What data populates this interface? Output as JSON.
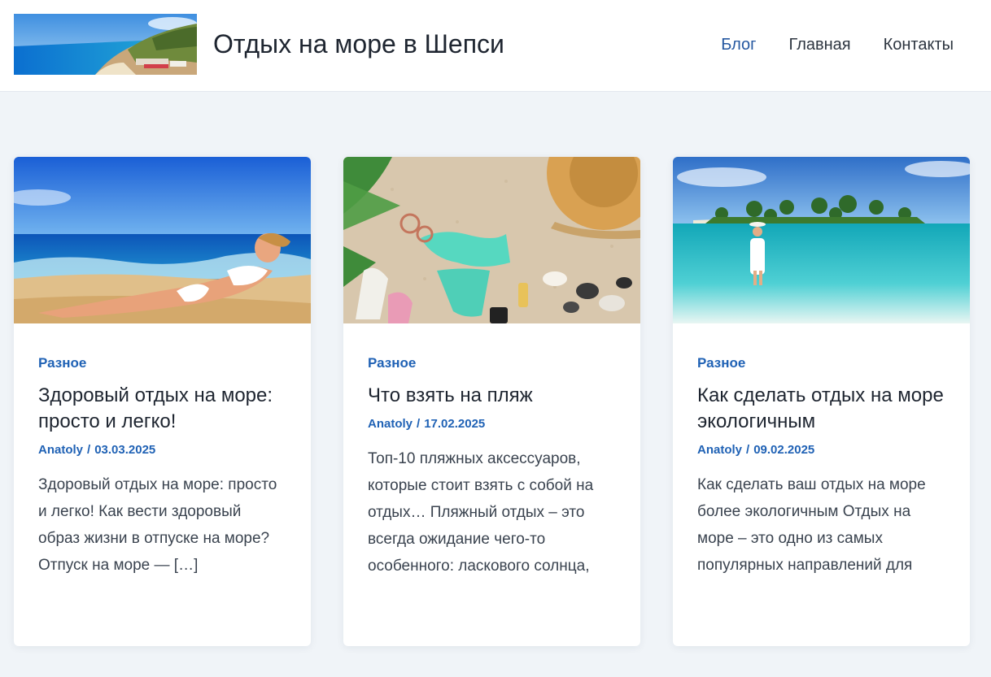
{
  "site": {
    "title": "Отдых на море в Шепси",
    "logo_icon": "coastline-photo"
  },
  "nav": {
    "items": [
      {
        "label": "Блог",
        "active": true
      },
      {
        "label": "Главная",
        "active": false
      },
      {
        "label": "Контакты",
        "active": false
      }
    ]
  },
  "colors": {
    "accent": "#2062b5",
    "background": "#f0f4f8",
    "card": "#ffffff"
  },
  "posts": [
    {
      "category": "Разное",
      "title": "Здоровый отдых на море: просто и легко!",
      "author": "Anatoly",
      "separator": "/",
      "date": "03.03.2025",
      "excerpt": "Здоровый отдых на море: просто и легко! Как вести здоровый образ жизни в отпуске на море? Отпуск на море — […]",
      "image_icon": "sunbathing-woman-photo"
    },
    {
      "category": "Разное",
      "title": "Что взять на пляж",
      "author": "Anatoly",
      "separator": "/",
      "date": "17.02.2025",
      "excerpt": "Топ-10 пляжных аксессуаров, которые стоит взять с собой на отдых… Пляжный отдых – это всегда ожидание чего-то особенного: ласкового солнца,",
      "image_icon": "beach-accessories-photo"
    },
    {
      "category": "Разное",
      "title": "Как сделать отдых на море экологичным",
      "author": "Anatoly",
      "separator": "/",
      "date": "09.02.2025",
      "excerpt": "Как сделать ваш отдых на море более экологичным   Отдых на море – это одно из самых популярных направлений для",
      "image_icon": "tropical-island-photo"
    }
  ]
}
